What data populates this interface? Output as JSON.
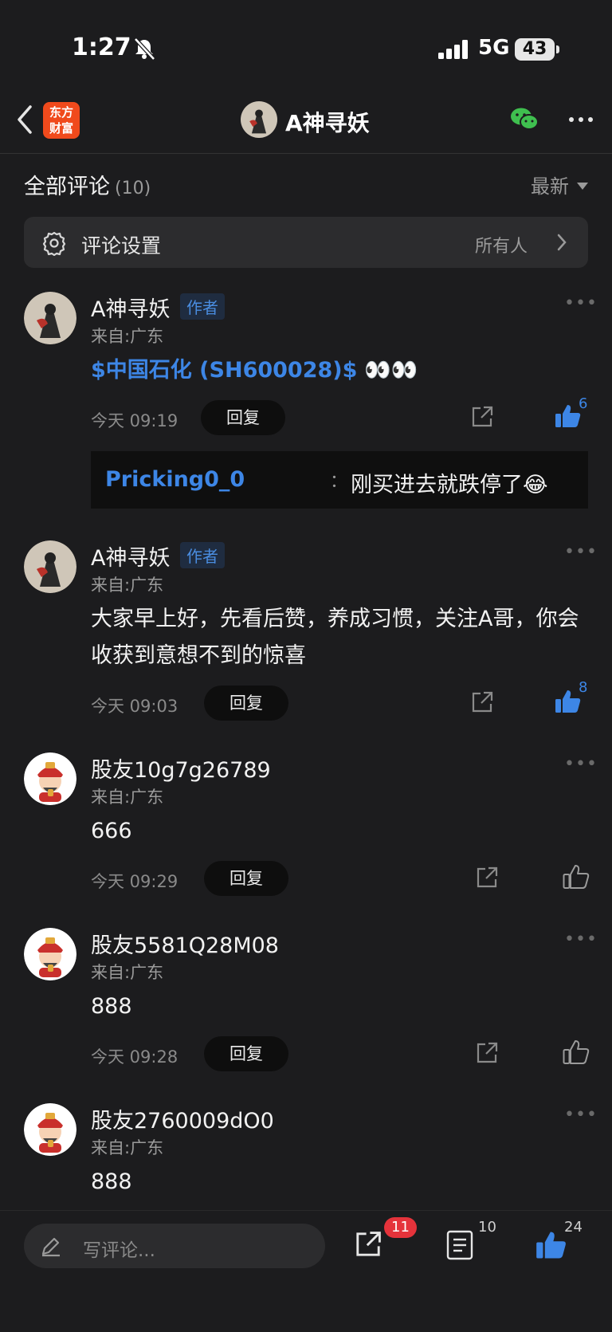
{
  "status_bar": {
    "time": "1:27",
    "network": "5G",
    "battery": "43"
  },
  "nav": {
    "title": "A神寻妖",
    "logo_line1": "东方",
    "logo_line2": "财富"
  },
  "section": {
    "title": "全部评论",
    "count": "(10)",
    "sort": "最新"
  },
  "settings": {
    "label": "评论设置",
    "value": "所有人"
  },
  "comments": [
    {
      "name": "A神寻妖",
      "badge": "作者",
      "location": "来自:广东",
      "text": "$中国石化 (SH600028)$",
      "emoji": "👀👀",
      "time": "今天 09:19",
      "reply": "回复",
      "likes": "6",
      "liked": true
    },
    {
      "name": "A神寻妖",
      "badge": "作者",
      "location": "来自:广东",
      "text": "大家早上好，先看后赞，养成习惯，关注A哥，你会收获到意想不到的惊喜",
      "time": "今天 09:03",
      "reply": "回复",
      "likes": "8",
      "liked": true
    },
    {
      "name": "股友10g7g26789",
      "location": "来自:广东",
      "text": "666",
      "time": "今天 09:29",
      "reply": "回复",
      "liked": false
    },
    {
      "name": "股友5581Q28M08",
      "location": "来自:广东",
      "text": "888",
      "time": "今天 09:28",
      "reply": "回复",
      "liked": false
    },
    {
      "name": "股友2760009dO0",
      "location": "来自:广东",
      "text": "888"
    }
  ],
  "sub_reply": {
    "user": "Pricking0_0",
    "separator": "：",
    "text": "刚买进去就跌停了😂"
  },
  "bottom": {
    "placeholder": "写评论...",
    "share_count": "11",
    "comment_count": "10",
    "like_count": "24"
  },
  "colors": {
    "background": "#1c1c1e",
    "accent_blue": "#3d86e6",
    "brand_orange": "#f04a1c",
    "badge_red": "#e5333b",
    "wechat_green": "#3fbf4f"
  }
}
